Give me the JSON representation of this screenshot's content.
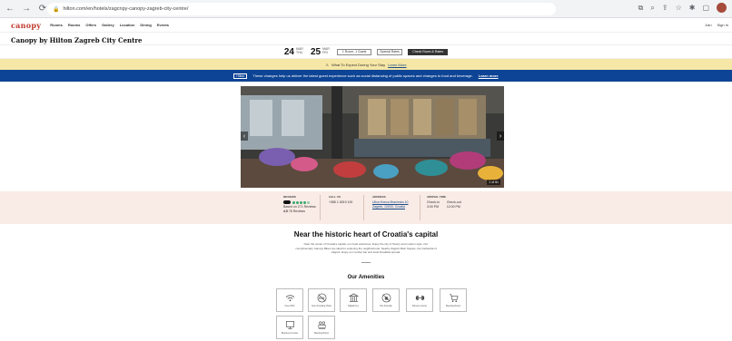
{
  "browser": {
    "url": "hilton.com/en/hotels/zagcnpy-canopy-zagreb-city-centre/"
  },
  "site": {
    "logo": "canopy",
    "nav": [
      "Rooms",
      "Rooms",
      "Offers",
      "Gallery",
      "Location",
      "Dining",
      "Events"
    ],
    "top_right": [
      "Join",
      "Sign In"
    ]
  },
  "hotel": {
    "title": "Canopy by Hilton Zagreb City Centre"
  },
  "booking": {
    "checkin_day": "24",
    "checkin_sub": "MAR THU",
    "checkout_day": "25",
    "checkout_sub": "MAR FRI",
    "rooms_label": "1 Room, 1 Guest",
    "rate_label": "Special Rates",
    "check_button": "Check Room & Rates"
  },
  "alert": {
    "text": "What To Expect During Your Stay",
    "link": "Learn More"
  },
  "promo": {
    "badge": "Hilton",
    "text": "These changes help us deliver the latest guest experience such as social distancing of public spaces and changes to food and beverage.",
    "link": "Learn more"
  },
  "hero": {
    "counter": "1 of 51"
  },
  "info": {
    "reviews_label": "Reviews",
    "reviews_text": "Based on 271 Reviews",
    "rating_score": "4.5",
    "rating_count": "78 Reviews",
    "call_label": "Call us",
    "call_val": "+385 1 6519 100",
    "address_label": "Address",
    "address_line1": "Ulica Kneza Branimira 10",
    "address_line2": "Zagreb, 10000, Croatia",
    "arrival_label": "Arrival time",
    "checkin": "Check-in",
    "checkin_time": "3:00 PM",
    "checkout": "Check-out",
    "checkout_time": "12:00 PM"
  },
  "near": {
    "title": "Near the historic heart of Croatia's capital",
    "desc": "Near the center of Croatia's capital, our hotel welcomes. Enjoy the city of history and modern style. Our complimentary Canopy Bikes are ideal for exploring the neighborhood. Nearby Zagreb Main Square, the Cathedral of Zagreb. Enjoy our rooftop bar and local breakfast spread."
  },
  "amenities": {
    "title": "Our Amenities",
    "items": [
      {
        "label": "Free WiFi",
        "icon": "wifi-icon"
      },
      {
        "label": "Non-Smoking Hotel",
        "icon": "no-smoking-icon"
      },
      {
        "label": "Digital Key",
        "icon": "building-icon"
      },
      {
        "label": "Pet Friendly",
        "icon": "no-pets-icon"
      },
      {
        "label": "Fitness Center",
        "icon": "dumbbell-icon"
      },
      {
        "label": "Meeting Room",
        "icon": "cart-icon"
      },
      {
        "label": "Business Center",
        "icon": "computer-icon"
      },
      {
        "label": "Meeting Room",
        "icon": "people-icon"
      }
    ]
  }
}
